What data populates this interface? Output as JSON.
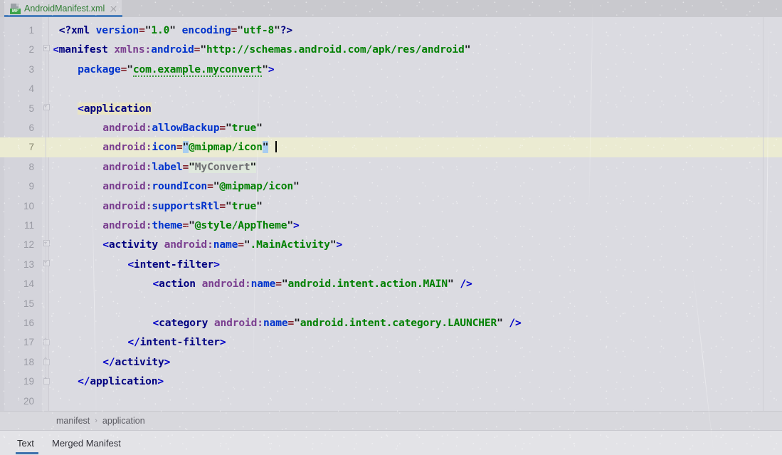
{
  "window": {
    "app": "Android Studio XML Editor",
    "background_color": "#dbdbe1"
  },
  "tab_bar": {
    "active_tab": {
      "label": "AndroidManifest.xml",
      "icon": "manifest-file-icon",
      "icon_badge": "MF",
      "label_color": "#2e7d32",
      "close_icon": "close-icon",
      "underline_color": "#4a7ebb"
    }
  },
  "editor": {
    "current_line": 7,
    "caret_line": 7,
    "font": "monospace-bold",
    "line_count_visible": 20,
    "colors": {
      "background": "#dbdbe1",
      "gutter": "#d4d4db",
      "current_line_highlight": "#ebebd2",
      "tag_match_highlight": "#e9e4c3",
      "selection_highlight": "#a8cdf0",
      "punctuation": "#0000c8",
      "tag_name": "#000080",
      "namespace_prefix": "#7a3e8f",
      "attribute_name": "#0033cc",
      "equals": "#80202a",
      "value": "#008000",
      "quote": "#17181a"
    },
    "line_numbers": [
      1,
      2,
      3,
      4,
      5,
      6,
      7,
      8,
      9,
      10,
      11,
      12,
      13,
      14,
      15,
      16,
      17,
      18,
      19,
      20
    ],
    "fold_markers": {
      "open": [
        2,
        5,
        12,
        13
      ],
      "close": [
        17,
        18,
        19
      ]
    },
    "lines": [
      {
        "n": 1,
        "indent": 1,
        "tokens": [
          {
            "t": "proc",
            "v": "<?"
          },
          {
            "t": "tag",
            "v": "xml"
          },
          {
            "t": "sp",
            "v": " "
          },
          {
            "t": "attr",
            "v": "version"
          },
          {
            "t": "eq",
            "v": "="
          },
          {
            "t": "quote",
            "v": "\""
          },
          {
            "t": "val",
            "v": "1.0"
          },
          {
            "t": "quote",
            "v": "\""
          },
          {
            "t": "sp",
            "v": " "
          },
          {
            "t": "attr",
            "v": "encoding"
          },
          {
            "t": "eq",
            "v": "="
          },
          {
            "t": "quote",
            "v": "\""
          },
          {
            "t": "val",
            "v": "utf-8"
          },
          {
            "t": "quote",
            "v": "\""
          },
          {
            "t": "proc",
            "v": "?>"
          }
        ]
      },
      {
        "n": 2,
        "indent": 0,
        "tokens": [
          {
            "t": "punct",
            "v": "<"
          },
          {
            "t": "tag",
            "v": "manifest"
          },
          {
            "t": "sp",
            "v": " "
          },
          {
            "t": "ns",
            "v": "xmlns:"
          },
          {
            "t": "attr",
            "v": "android"
          },
          {
            "t": "eq",
            "v": "="
          },
          {
            "t": "quote",
            "v": "\""
          },
          {
            "t": "val",
            "v": "http://schemas.android.com/apk/res/android"
          },
          {
            "t": "quote",
            "v": "\""
          }
        ]
      },
      {
        "n": 3,
        "indent": 4,
        "tokens": [
          {
            "t": "attr",
            "v": "package"
          },
          {
            "t": "eq",
            "v": "="
          },
          {
            "t": "quote",
            "v": "\""
          },
          {
            "t": "val-squiggle",
            "v": "com.example.myconvert"
          },
          {
            "t": "quote",
            "v": "\""
          },
          {
            "t": "punct",
            "v": ">"
          }
        ]
      },
      {
        "n": 4,
        "indent": 0,
        "tokens": []
      },
      {
        "n": 5,
        "indent": 4,
        "tokens": [
          {
            "t": "hl-open",
            "v": ""
          },
          {
            "t": "punct",
            "v": "<"
          },
          {
            "t": "tag",
            "v": "application"
          },
          {
            "t": "hl-close",
            "v": ""
          }
        ]
      },
      {
        "n": 6,
        "indent": 8,
        "tokens": [
          {
            "t": "ns",
            "v": "android:"
          },
          {
            "t": "attr",
            "v": "allowBackup"
          },
          {
            "t": "eq",
            "v": "="
          },
          {
            "t": "quote",
            "v": "\""
          },
          {
            "t": "val",
            "v": "true"
          },
          {
            "t": "quote",
            "v": "\""
          }
        ]
      },
      {
        "n": 7,
        "indent": 8,
        "current": true,
        "tokens": [
          {
            "t": "ns",
            "v": "android:"
          },
          {
            "t": "attr",
            "v": "icon"
          },
          {
            "t": "eq",
            "v": "="
          },
          {
            "t": "sel-quote",
            "v": "\""
          },
          {
            "t": "val",
            "v": "@mipmap/icon"
          },
          {
            "t": "sel-quote",
            "v": "\""
          },
          {
            "t": "sp",
            "v": " "
          },
          {
            "t": "caret",
            "v": ""
          }
        ]
      },
      {
        "n": 8,
        "indent": 8,
        "tokens": [
          {
            "t": "ns",
            "v": "android:"
          },
          {
            "t": "attr",
            "v": "label"
          },
          {
            "t": "eq",
            "v": "="
          },
          {
            "t": "soft-quote",
            "v": "\""
          },
          {
            "t": "soft-val",
            "v": "MyConvert"
          },
          {
            "t": "soft-quote",
            "v": "\""
          }
        ]
      },
      {
        "n": 9,
        "indent": 8,
        "tokens": [
          {
            "t": "ns",
            "v": "android:"
          },
          {
            "t": "attr",
            "v": "roundIcon"
          },
          {
            "t": "eq",
            "v": "="
          },
          {
            "t": "quote",
            "v": "\""
          },
          {
            "t": "val",
            "v": "@mipmap/icon"
          },
          {
            "t": "quote",
            "v": "\""
          }
        ]
      },
      {
        "n": 10,
        "indent": 8,
        "tokens": [
          {
            "t": "ns",
            "v": "android:"
          },
          {
            "t": "attr",
            "v": "supportsRtl"
          },
          {
            "t": "eq",
            "v": "="
          },
          {
            "t": "quote",
            "v": "\""
          },
          {
            "t": "val",
            "v": "true"
          },
          {
            "t": "quote",
            "v": "\""
          }
        ]
      },
      {
        "n": 11,
        "indent": 8,
        "tokens": [
          {
            "t": "ns",
            "v": "android:"
          },
          {
            "t": "attr",
            "v": "theme"
          },
          {
            "t": "eq",
            "v": "="
          },
          {
            "t": "quote",
            "v": "\""
          },
          {
            "t": "val",
            "v": "@style/AppTheme"
          },
          {
            "t": "quote",
            "v": "\""
          },
          {
            "t": "punct",
            "v": ">"
          }
        ]
      },
      {
        "n": 12,
        "indent": 8,
        "tokens": [
          {
            "t": "punct",
            "v": "<"
          },
          {
            "t": "tag",
            "v": "activity"
          },
          {
            "t": "sp",
            "v": " "
          },
          {
            "t": "ns",
            "v": "android:"
          },
          {
            "t": "attr",
            "v": "name"
          },
          {
            "t": "eq",
            "v": "="
          },
          {
            "t": "quote",
            "v": "\""
          },
          {
            "t": "val",
            "v": ".MainActivity"
          },
          {
            "t": "quote",
            "v": "\""
          },
          {
            "t": "punct",
            "v": ">"
          }
        ]
      },
      {
        "n": 13,
        "indent": 12,
        "tokens": [
          {
            "t": "punct",
            "v": "<"
          },
          {
            "t": "tag",
            "v": "intent-filter"
          },
          {
            "t": "punct",
            "v": ">"
          }
        ]
      },
      {
        "n": 14,
        "indent": 16,
        "tokens": [
          {
            "t": "punct",
            "v": "<"
          },
          {
            "t": "tag",
            "v": "action"
          },
          {
            "t": "sp",
            "v": " "
          },
          {
            "t": "ns",
            "v": "android:"
          },
          {
            "t": "attr",
            "v": "name"
          },
          {
            "t": "eq",
            "v": "="
          },
          {
            "t": "quote",
            "v": "\""
          },
          {
            "t": "val",
            "v": "android.intent.action.MAIN"
          },
          {
            "t": "quote",
            "v": "\""
          },
          {
            "t": "sp",
            "v": " "
          },
          {
            "t": "punct",
            "v": "/>"
          }
        ]
      },
      {
        "n": 15,
        "indent": 0,
        "tokens": []
      },
      {
        "n": 16,
        "indent": 16,
        "tokens": [
          {
            "t": "punct",
            "v": "<"
          },
          {
            "t": "tag",
            "v": "category"
          },
          {
            "t": "sp",
            "v": " "
          },
          {
            "t": "ns",
            "v": "android:"
          },
          {
            "t": "attr",
            "v": "name"
          },
          {
            "t": "eq",
            "v": "="
          },
          {
            "t": "quote",
            "v": "\""
          },
          {
            "t": "val",
            "v": "android.intent.category.LAUNCHER"
          },
          {
            "t": "quote",
            "v": "\""
          },
          {
            "t": "sp",
            "v": " "
          },
          {
            "t": "punct",
            "v": "/>"
          }
        ]
      },
      {
        "n": 17,
        "indent": 12,
        "tokens": [
          {
            "t": "punct",
            "v": "</"
          },
          {
            "t": "tag",
            "v": "intent-filter"
          },
          {
            "t": "punct",
            "v": ">"
          }
        ]
      },
      {
        "n": 18,
        "indent": 8,
        "tokens": [
          {
            "t": "punct",
            "v": "</"
          },
          {
            "t": "tag",
            "v": "activity"
          },
          {
            "t": "punct",
            "v": ">"
          }
        ]
      },
      {
        "n": 19,
        "indent": 4,
        "tokens": [
          {
            "t": "punct",
            "v": "</"
          },
          {
            "t": "tag",
            "v": "application"
          },
          {
            "t": "punct",
            "v": ">"
          }
        ]
      },
      {
        "n": 20,
        "indent": 0,
        "tokens": []
      }
    ]
  },
  "breadcrumb": {
    "items": [
      "manifest",
      "application"
    ],
    "separator": "›"
  },
  "bottom_tabs": {
    "items": [
      {
        "label": "Text",
        "active": true
      },
      {
        "label": "Merged Manifest",
        "active": false
      }
    ],
    "active_underline_color": "#3f72ad"
  }
}
